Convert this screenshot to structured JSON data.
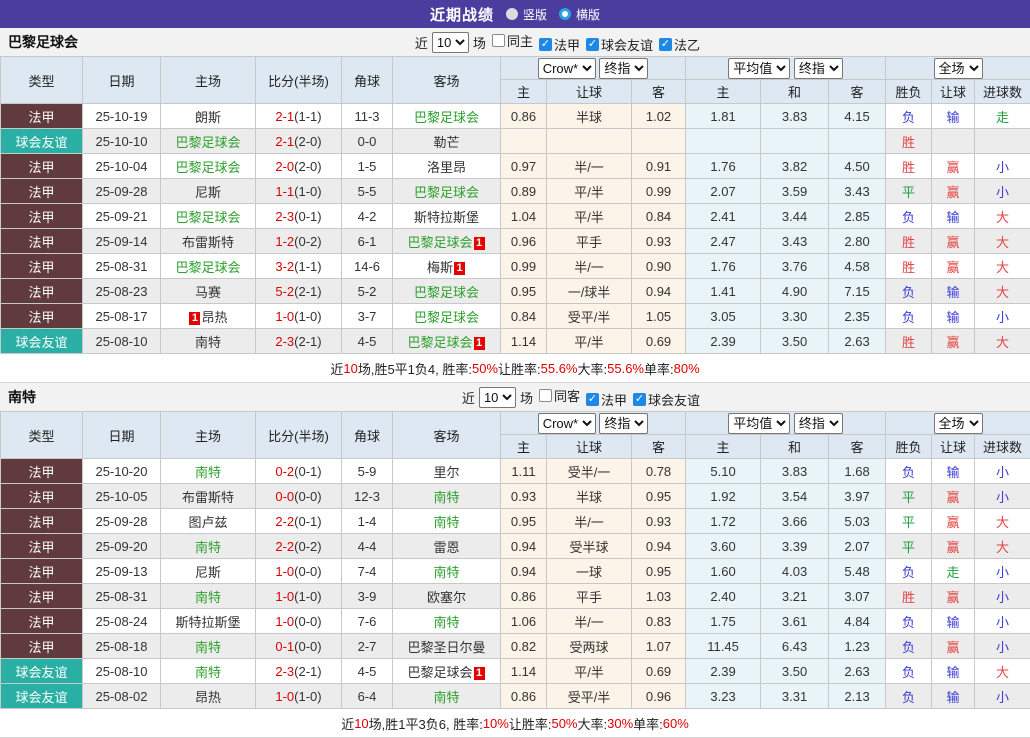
{
  "topbar": {
    "title": "近期战绩",
    "vertical_label": "竖版",
    "horizontal_label": "横版"
  },
  "colors": {
    "topbar_bg": "#4b3d9e",
    "league_bg": "#603a3c",
    "friendly_bg": "#2aafa5",
    "team_green": "#2ca02c",
    "score_red": "#dd0000",
    "win_red": "#e34444",
    "lose_blue": "#3b3bd6",
    "draw_green": "#21a03c",
    "checkbox_blue": "#1e88e5",
    "odds_col_bg": "#fcf4e8",
    "avg_col_bg": "#e8f4f8",
    "header_bg": "#dde8f2"
  },
  "table_header": {
    "main": [
      "类型",
      "日期",
      "主场",
      "比分(半场)",
      "角球",
      "客场"
    ],
    "group1_select1": "Crow*",
    "group1_select2": "终指",
    "group2_select1": "平均值",
    "group2_select2": "终指",
    "group3_select": "全场",
    "sub1": [
      "主",
      "让球",
      "客"
    ],
    "sub2": [
      "主",
      "和",
      "客"
    ],
    "sub3": [
      "胜负",
      "让球",
      "进球数"
    ]
  },
  "sections": [
    {
      "team": "巴黎足球会",
      "filter": {
        "prefix": "近",
        "count": "10",
        "suffix": "场",
        "checks": [
          {
            "label": "同主",
            "checked": false
          },
          {
            "label": "法甲",
            "checked": true
          },
          {
            "label": "球会友谊",
            "checked": true
          },
          {
            "label": "法乙",
            "checked": true
          }
        ]
      },
      "rows": [
        {
          "type": "法甲",
          "type_style": "league",
          "date": "25-10-19",
          "home": {
            "name": "朗斯",
            "green": false
          },
          "score": "2-1",
          "half": "(1-1)",
          "corner": "11-3",
          "away": {
            "name": "巴黎足球会",
            "green": true
          },
          "odds": [
            "0.86",
            "半球",
            "1.02"
          ],
          "avg": [
            "1.81",
            "3.83",
            "4.15"
          ],
          "results": [
            {
              "t": "负",
              "c": "blue"
            },
            {
              "t": "输",
              "c": "blue"
            },
            {
              "t": "走",
              "c": "green"
            }
          ]
        },
        {
          "type": "球会友谊",
          "type_style": "friendly",
          "date": "25-10-10",
          "home": {
            "name": "巴黎足球会",
            "green": true
          },
          "score": "2-1",
          "half": "(2-0)",
          "corner": "0-0",
          "away": {
            "name": "勒芒",
            "green": false
          },
          "odds": [
            "",
            "",
            ""
          ],
          "avg": [
            "",
            "",
            ""
          ],
          "results": [
            {
              "t": "胜",
              "c": "red"
            },
            {
              "t": "",
              "c": ""
            },
            {
              "t": "",
              "c": ""
            }
          ]
        },
        {
          "type": "法甲",
          "type_style": "league",
          "date": "25-10-04",
          "home": {
            "name": "巴黎足球会",
            "green": true
          },
          "score": "2-0",
          "half": "(2-0)",
          "corner": "1-5",
          "away": {
            "name": "洛里昂",
            "green": false
          },
          "odds": [
            "0.97",
            "半/一",
            "0.91"
          ],
          "avg": [
            "1.76",
            "3.82",
            "4.50"
          ],
          "results": [
            {
              "t": "胜",
              "c": "red"
            },
            {
              "t": "赢",
              "c": "red"
            },
            {
              "t": "小",
              "c": "blue"
            }
          ]
        },
        {
          "type": "法甲",
          "type_style": "league",
          "date": "25-09-28",
          "home": {
            "name": "尼斯",
            "green": false
          },
          "score": "1-1",
          "half": "(1-0)",
          "corner": "5-5",
          "away": {
            "name": "巴黎足球会",
            "green": true
          },
          "odds": [
            "0.89",
            "平/半",
            "0.99"
          ],
          "avg": [
            "2.07",
            "3.59",
            "3.43"
          ],
          "results": [
            {
              "t": "平",
              "c": "green"
            },
            {
              "t": "赢",
              "c": "red"
            },
            {
              "t": "小",
              "c": "blue"
            }
          ]
        },
        {
          "type": "法甲",
          "type_style": "league",
          "date": "25-09-21",
          "home": {
            "name": "巴黎足球会",
            "green": true
          },
          "score": "2-3",
          "half": "(0-1)",
          "corner": "4-2",
          "away": {
            "name": "斯特拉斯堡",
            "green": false
          },
          "odds": [
            "1.04",
            "平/半",
            "0.84"
          ],
          "avg": [
            "2.41",
            "3.44",
            "2.85"
          ],
          "results": [
            {
              "t": "负",
              "c": "blue"
            },
            {
              "t": "输",
              "c": "blue"
            },
            {
              "t": "大",
              "c": "red"
            }
          ]
        },
        {
          "type": "法甲",
          "type_style": "league",
          "date": "25-09-14",
          "home": {
            "name": "布雷斯特",
            "green": false
          },
          "score": "1-2",
          "half": "(0-2)",
          "corner": "6-1",
          "away": {
            "name": "巴黎足球会",
            "green": true,
            "badge": "1",
            "badge_pos": "after"
          },
          "odds": [
            "0.96",
            "平手",
            "0.93"
          ],
          "avg": [
            "2.47",
            "3.43",
            "2.80"
          ],
          "results": [
            {
              "t": "胜",
              "c": "red"
            },
            {
              "t": "赢",
              "c": "red"
            },
            {
              "t": "大",
              "c": "red"
            }
          ]
        },
        {
          "type": "法甲",
          "type_style": "league",
          "date": "25-08-31",
          "home": {
            "name": "巴黎足球会",
            "green": true
          },
          "score": "3-2",
          "half": "(1-1)",
          "corner": "14-6",
          "away": {
            "name": "梅斯",
            "green": false,
            "badge": "1",
            "badge_pos": "after"
          },
          "odds": [
            "0.99",
            "半/一",
            "0.90"
          ],
          "avg": [
            "1.76",
            "3.76",
            "4.58"
          ],
          "results": [
            {
              "t": "胜",
              "c": "red"
            },
            {
              "t": "赢",
              "c": "red"
            },
            {
              "t": "大",
              "c": "red"
            }
          ]
        },
        {
          "type": "法甲",
          "type_style": "league",
          "date": "25-08-23",
          "home": {
            "name": "马赛",
            "green": false
          },
          "score": "5-2",
          "half": "(2-1)",
          "corner": "5-2",
          "away": {
            "name": "巴黎足球会",
            "green": true
          },
          "odds": [
            "0.95",
            "一/球半",
            "0.94"
          ],
          "avg": [
            "1.41",
            "4.90",
            "7.15"
          ],
          "results": [
            {
              "t": "负",
              "c": "blue"
            },
            {
              "t": "输",
              "c": "blue"
            },
            {
              "t": "大",
              "c": "red"
            }
          ]
        },
        {
          "type": "法甲",
          "type_style": "league",
          "date": "25-08-17",
          "home": {
            "name": "昂热",
            "green": false,
            "badge": "1",
            "badge_pos": "before"
          },
          "score": "1-0",
          "half": "(1-0)",
          "corner": "3-7",
          "away": {
            "name": "巴黎足球会",
            "green": true
          },
          "odds": [
            "0.84",
            "受平/半",
            "1.05"
          ],
          "avg": [
            "3.05",
            "3.30",
            "2.35"
          ],
          "results": [
            {
              "t": "负",
              "c": "blue"
            },
            {
              "t": "输",
              "c": "blue"
            },
            {
              "t": "小",
              "c": "blue"
            }
          ]
        },
        {
          "type": "球会友谊",
          "type_style": "friendly",
          "date": "25-08-10",
          "home": {
            "name": "南特",
            "green": false
          },
          "score": "2-3",
          "half": "(2-1)",
          "corner": "4-5",
          "away": {
            "name": "巴黎足球会",
            "green": true,
            "badge": "1",
            "badge_pos": "after"
          },
          "odds": [
            "1.14",
            "平/半",
            "0.69"
          ],
          "avg": [
            "2.39",
            "3.50",
            "2.63"
          ],
          "results": [
            {
              "t": "胜",
              "c": "red"
            },
            {
              "t": "赢",
              "c": "red"
            },
            {
              "t": "大",
              "c": "red"
            }
          ]
        }
      ],
      "summary": [
        {
          "t": "近",
          "red": false
        },
        {
          "t": "10",
          "red": true
        },
        {
          "t": "场,胜5平1负4, 胜率:",
          "red": false
        },
        {
          "t": "50%",
          "red": true
        },
        {
          "t": " 让胜率:",
          "red": false
        },
        {
          "t": "55.6%",
          "red": true
        },
        {
          "t": " 大率:",
          "red": false
        },
        {
          "t": "55.6%",
          "red": true
        },
        {
          "t": " 单率:",
          "red": false
        },
        {
          "t": "80%",
          "red": true
        }
      ]
    },
    {
      "team": "南特",
      "filter": {
        "prefix": "近",
        "count": "10",
        "suffix": "场",
        "checks": [
          {
            "label": "同客",
            "checked": false
          },
          {
            "label": "法甲",
            "checked": true
          },
          {
            "label": "球会友谊",
            "checked": true
          }
        ]
      },
      "rows": [
        {
          "type": "法甲",
          "type_style": "league",
          "date": "25-10-20",
          "home": {
            "name": "南特",
            "green": true
          },
          "score": "0-2",
          "half": "(0-1)",
          "corner": "5-9",
          "away": {
            "name": "里尔",
            "green": false
          },
          "odds": [
            "1.11",
            "受半/一",
            "0.78"
          ],
          "avg": [
            "5.10",
            "3.83",
            "1.68"
          ],
          "results": [
            {
              "t": "负",
              "c": "blue"
            },
            {
              "t": "输",
              "c": "blue"
            },
            {
              "t": "小",
              "c": "blue"
            }
          ]
        },
        {
          "type": "法甲",
          "type_style": "league",
          "date": "25-10-05",
          "home": {
            "name": "布雷斯特",
            "green": false
          },
          "score": "0-0",
          "half": "(0-0)",
          "corner": "12-3",
          "away": {
            "name": "南特",
            "green": true
          },
          "odds": [
            "0.93",
            "半球",
            "0.95"
          ],
          "avg": [
            "1.92",
            "3.54",
            "3.97"
          ],
          "results": [
            {
              "t": "平",
              "c": "green"
            },
            {
              "t": "赢",
              "c": "red"
            },
            {
              "t": "小",
              "c": "blue"
            }
          ]
        },
        {
          "type": "法甲",
          "type_style": "league",
          "date": "25-09-28",
          "home": {
            "name": "图卢兹",
            "green": false
          },
          "score": "2-2",
          "half": "(0-1)",
          "corner": "1-4",
          "away": {
            "name": "南特",
            "green": true
          },
          "odds": [
            "0.95",
            "半/一",
            "0.93"
          ],
          "avg": [
            "1.72",
            "3.66",
            "5.03"
          ],
          "results": [
            {
              "t": "平",
              "c": "green"
            },
            {
              "t": "赢",
              "c": "red"
            },
            {
              "t": "大",
              "c": "red"
            }
          ]
        },
        {
          "type": "法甲",
          "type_style": "league",
          "date": "25-09-20",
          "home": {
            "name": "南特",
            "green": true
          },
          "score": "2-2",
          "half": "(0-2)",
          "corner": "4-4",
          "away": {
            "name": "雷恩",
            "green": false
          },
          "odds": [
            "0.94",
            "受半球",
            "0.94"
          ],
          "avg": [
            "3.60",
            "3.39",
            "2.07"
          ],
          "results": [
            {
              "t": "平",
              "c": "green"
            },
            {
              "t": "赢",
              "c": "red"
            },
            {
              "t": "大",
              "c": "red"
            }
          ]
        },
        {
          "type": "法甲",
          "type_style": "league",
          "date": "25-09-13",
          "home": {
            "name": "尼斯",
            "green": false
          },
          "score": "1-0",
          "half": "(0-0)",
          "corner": "7-4",
          "away": {
            "name": "南特",
            "green": true
          },
          "odds": [
            "0.94",
            "一球",
            "0.95"
          ],
          "avg": [
            "1.60",
            "4.03",
            "5.48"
          ],
          "results": [
            {
              "t": "负",
              "c": "blue"
            },
            {
              "t": "走",
              "c": "green"
            },
            {
              "t": "小",
              "c": "blue"
            }
          ]
        },
        {
          "type": "法甲",
          "type_style": "league",
          "date": "25-08-31",
          "home": {
            "name": "南特",
            "green": true
          },
          "score": "1-0",
          "half": "(1-0)",
          "corner": "3-9",
          "away": {
            "name": "欧塞尔",
            "green": false
          },
          "odds": [
            "0.86",
            "平手",
            "1.03"
          ],
          "avg": [
            "2.40",
            "3.21",
            "3.07"
          ],
          "results": [
            {
              "t": "胜",
              "c": "red"
            },
            {
              "t": "赢",
              "c": "red"
            },
            {
              "t": "小",
              "c": "blue"
            }
          ]
        },
        {
          "type": "法甲",
          "type_style": "league",
          "date": "25-08-24",
          "home": {
            "name": "斯特拉斯堡",
            "green": false
          },
          "score": "1-0",
          "half": "(0-0)",
          "corner": "7-6",
          "away": {
            "name": "南特",
            "green": true
          },
          "odds": [
            "1.06",
            "半/一",
            "0.83"
          ],
          "avg": [
            "1.75",
            "3.61",
            "4.84"
          ],
          "results": [
            {
              "t": "负",
              "c": "blue"
            },
            {
              "t": "输",
              "c": "blue"
            },
            {
              "t": "小",
              "c": "blue"
            }
          ]
        },
        {
          "type": "法甲",
          "type_style": "league",
          "date": "25-08-18",
          "home": {
            "name": "南特",
            "green": true
          },
          "score": "0-1",
          "half": "(0-0)",
          "corner": "2-7",
          "away": {
            "name": "巴黎圣日尔曼",
            "green": false
          },
          "odds": [
            "0.82",
            "受两球",
            "1.07"
          ],
          "avg": [
            "11.45",
            "6.43",
            "1.23"
          ],
          "results": [
            {
              "t": "负",
              "c": "blue"
            },
            {
              "t": "赢",
              "c": "red"
            },
            {
              "t": "小",
              "c": "blue"
            }
          ]
        },
        {
          "type": "球会友谊",
          "type_style": "friendly",
          "date": "25-08-10",
          "home": {
            "name": "南特",
            "green": true
          },
          "score": "2-3",
          "half": "(2-1)",
          "corner": "4-5",
          "away": {
            "name": "巴黎足球会",
            "green": false,
            "badge": "1",
            "badge_pos": "after"
          },
          "odds": [
            "1.14",
            "平/半",
            "0.69"
          ],
          "avg": [
            "2.39",
            "3.50",
            "2.63"
          ],
          "results": [
            {
              "t": "负",
              "c": "blue"
            },
            {
              "t": "输",
              "c": "blue"
            },
            {
              "t": "大",
              "c": "red"
            }
          ]
        },
        {
          "type": "球会友谊",
          "type_style": "friendly",
          "date": "25-08-02",
          "home": {
            "name": "昂热",
            "green": false
          },
          "score": "1-0",
          "half": "(1-0)",
          "corner": "6-4",
          "away": {
            "name": "南特",
            "green": true
          },
          "odds": [
            "0.86",
            "受平/半",
            "0.96"
          ],
          "avg": [
            "3.23",
            "3.31",
            "2.13"
          ],
          "results": [
            {
              "t": "负",
              "c": "blue"
            },
            {
              "t": "输",
              "c": "blue"
            },
            {
              "t": "小",
              "c": "blue"
            }
          ]
        }
      ],
      "summary": [
        {
          "t": "近",
          "red": false
        },
        {
          "t": "10",
          "red": true
        },
        {
          "t": "场,胜1平3负6, 胜率:",
          "red": false
        },
        {
          "t": "10%",
          "red": true
        },
        {
          "t": " 让胜率:",
          "red": false
        },
        {
          "t": "50%",
          "red": true
        },
        {
          "t": " 大率:",
          "red": false
        },
        {
          "t": "30%",
          "red": true
        },
        {
          "t": " 单率:",
          "red": false
        },
        {
          "t": "60%",
          "red": true
        }
      ]
    }
  ]
}
